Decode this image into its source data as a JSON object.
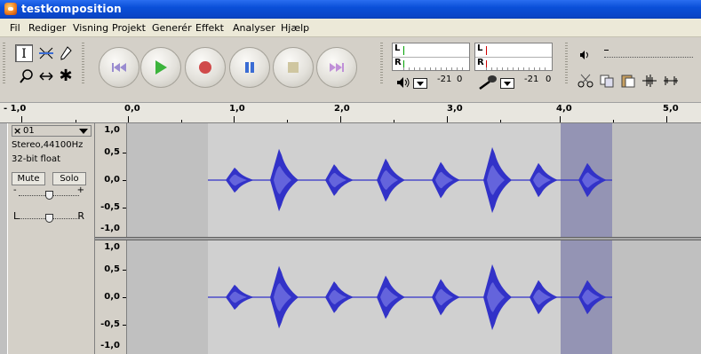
{
  "window": {
    "title": "testkomposition"
  },
  "menu": [
    "Fil",
    "Rediger",
    "Visning",
    "Projekt",
    "Generér",
    "Effekt",
    "Analyser",
    "Hjælp"
  ],
  "meters": {
    "play": {
      "left_label": "L",
      "right_label": "R",
      "scale_min": "-21",
      "scale_max": "0"
    },
    "record": {
      "left_label": "L",
      "right_label": "R",
      "scale_min": "-21",
      "scale_max": "0"
    }
  },
  "ruler": {
    "labels": [
      "- 1,0",
      "0,0",
      "1,0",
      "2,0",
      "3,0",
      "4,0",
      "5,0"
    ]
  },
  "track": {
    "name": "01",
    "format": "Stereo,44100Hz",
    "bitdepth": "32-bit float",
    "mute_label": "Mute",
    "solo_label": "Solo",
    "gain_minus": "-",
    "gain_plus": "+",
    "pan_left": "L",
    "pan_right": "R",
    "gain_value": 0.5,
    "pan_value": 0.5
  },
  "vruler_labels": [
    "1,0",
    "0,5",
    "0,0",
    "-0,5",
    "-1,0"
  ],
  "colors": {
    "waveform": "#3232c8",
    "waveform_rms": "#6464dc",
    "track_bg": "#c0c0c0",
    "clip_bg": "#d0d0d0",
    "selection": "#9494b4"
  }
}
